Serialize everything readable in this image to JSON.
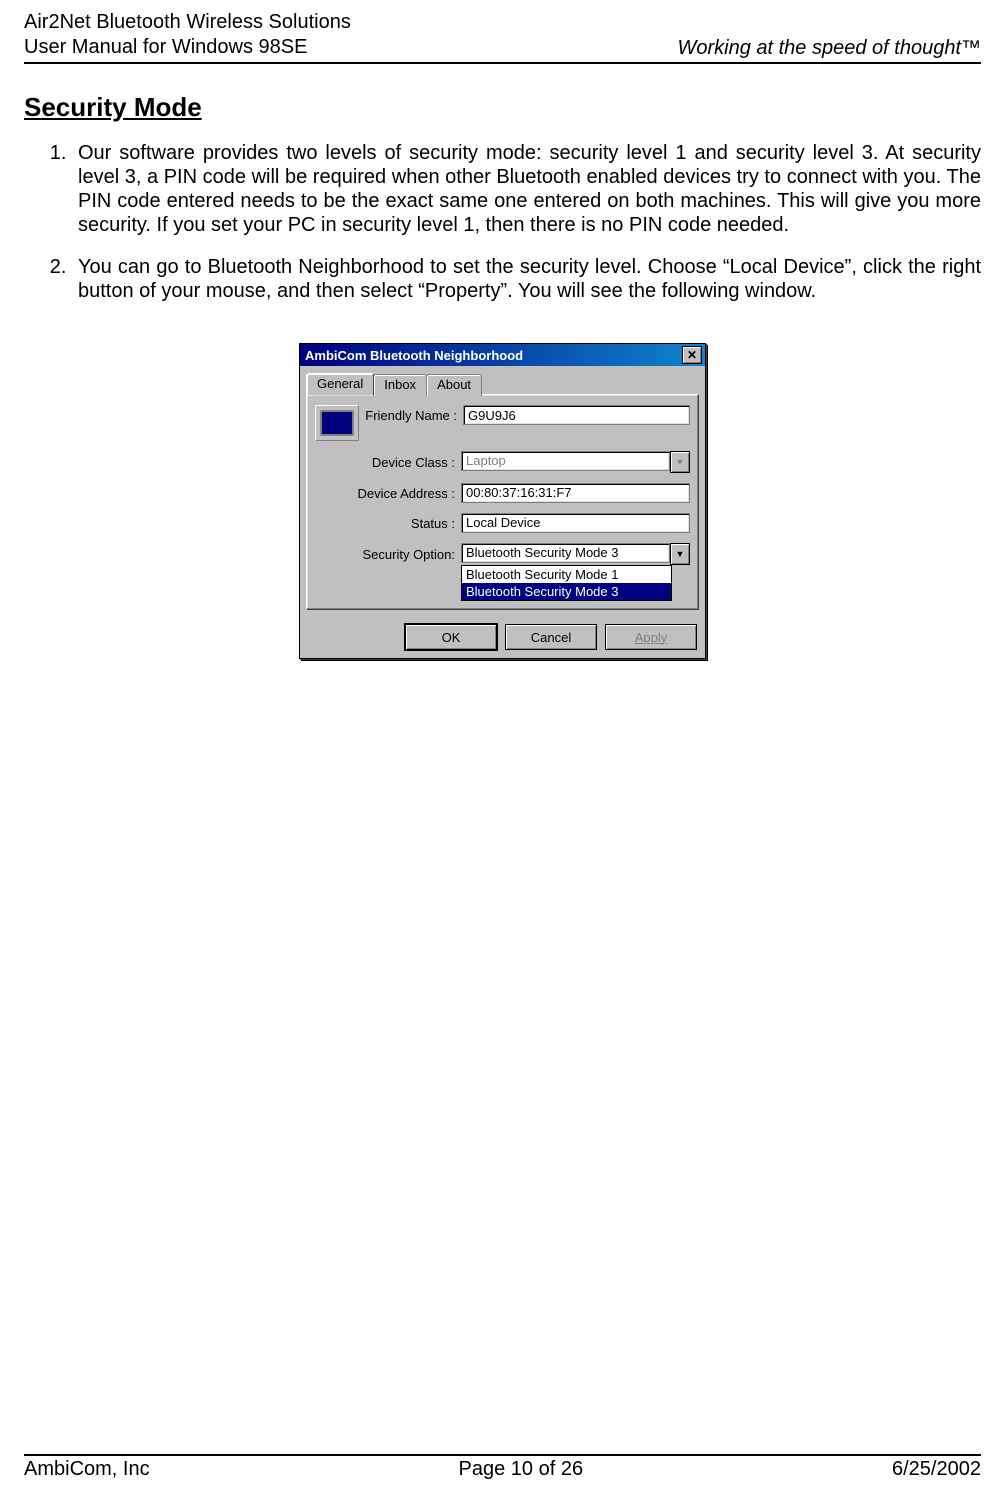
{
  "header": {
    "left_line1": "Air2Net Bluetooth Wireless Solutions",
    "left_line2": "User Manual for Windows 98SE",
    "right": "Working at the speed of thought™"
  },
  "section_title": "Security Mode",
  "list_items": [
    "Our software provides two levels of security mode: security level 1 and security level 3. At security level 3, a PIN code will be required when other Bluetooth enabled devices try to connect with you.  The PIN code entered needs to be the exact same one entered on both machines. This will give you more security. If you set your PC in security level 1, then there is no PIN code needed.",
    "You can go to Bluetooth Neighborhood to set the security level. Choose “Local Device”, click the right button of your mouse, and then select “Property”. You will see the following window."
  ],
  "dialog": {
    "title": "AmbiCom Bluetooth Neighborhood",
    "close_glyph": "✕",
    "tabs": {
      "general": "General",
      "inbox": "Inbox",
      "about": "About"
    },
    "labels": {
      "friendly_name": "Friendly Name :",
      "device_class": "Device Class :",
      "device_address": "Device Address :",
      "status": "Status :",
      "security_option": "Security Option:"
    },
    "values": {
      "friendly_name": "G9U9J6",
      "device_class": "Laptop",
      "device_address": "00:80:37:16:31:F7",
      "status": "Local Device",
      "security_option": "Bluetooth Security Mode 3"
    },
    "dropdown_options": [
      "Bluetooth Security Mode 1",
      "Bluetooth Security Mode 3"
    ],
    "dropdown_selected_index": 1,
    "buttons": {
      "ok": "OK",
      "cancel": "Cancel",
      "apply": "Apply"
    },
    "chevron": "▼"
  },
  "footer": {
    "left": "AmbiCom, Inc",
    "center": "Page 10 of 26",
    "right": "6/25/2002"
  }
}
